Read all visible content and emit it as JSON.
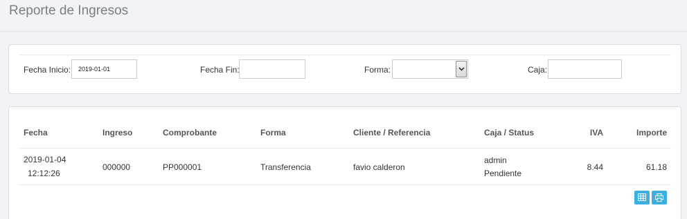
{
  "header": {
    "title": "Reporte de Ingresos"
  },
  "filters": {
    "fecha_inicio_label": "Fecha Inicio:",
    "fecha_inicio_value": "2019-01-01",
    "fecha_fin_label": "Fecha Fin:",
    "fecha_fin_value": "",
    "forma_label": "Forma:",
    "forma_value": "",
    "caja_label": "Caja:",
    "caja_value": ""
  },
  "table": {
    "columns": [
      "Fecha",
      "Ingreso",
      "Comprobante",
      "Forma",
      "Cliente / Referencia",
      "Caja / Status",
      "IVA",
      "Importe"
    ],
    "rows": [
      {
        "fecha": "2019-01-04",
        "hora": "12:12:26",
        "ingreso": "000000",
        "comprobante": "PP000001",
        "forma": "Transferencia",
        "cliente": "favio calderon",
        "caja": "admin",
        "status": "Pendiente",
        "iva": "8.44",
        "importe": "61.18"
      }
    ]
  },
  "actions": {
    "excel_icon": "table-icon",
    "print_icon": "print-icon"
  },
  "colors": {
    "accent": "#3bb0e0"
  }
}
